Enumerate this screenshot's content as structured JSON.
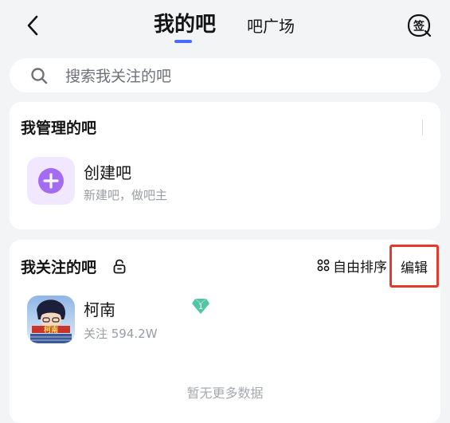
{
  "header": {
    "tabs": [
      {
        "label": "我的吧",
        "active": true
      },
      {
        "label": "吧广场",
        "active": false
      }
    ],
    "accent_color": "#4b6bff",
    "sign_icon_char": "签"
  },
  "search": {
    "placeholder": "搜索我关注的吧"
  },
  "managed": {
    "title": "我管理的吧",
    "create": {
      "label": "创建吧",
      "subtitle": "新建吧，做吧主",
      "icon_color": "#a46cf2"
    }
  },
  "followed": {
    "title": "我关注的吧",
    "sort_label": "自由排序",
    "edit_label": "编辑",
    "items": [
      {
        "name": "柯南",
        "followers": "关注 594.2W",
        "level": "1",
        "avatar_text": "柯南"
      }
    ],
    "empty_text": "暂无更多数据"
  }
}
